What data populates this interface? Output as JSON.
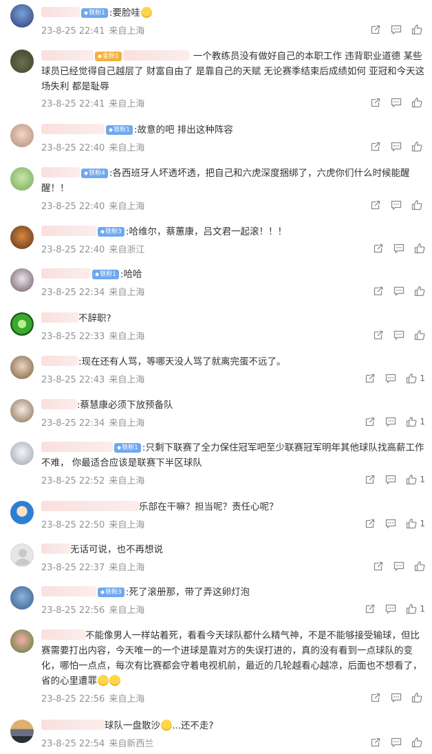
{
  "comments": [
    {
      "text": ":要脸哇",
      "emoji": "blush",
      "badge": "铁粉1",
      "badge_color": "#6fa8f0",
      "time": "23-8-25 22:41",
      "location": "来自上海",
      "likes": ""
    },
    {
      "text": "一个教练员没有做好自己的本职工作 违背职业道德 某些球员已经觉得自己越层了 财富自由了 是靠自己的天赋 无论赛季结束后成绩如何 亚冠和今天这场失利 都是耻辱",
      "badge": "金粉1",
      "badge_color": "#f3b23b",
      "time": "23-8-25 22:41",
      "location": "来自上海",
      "likes": ""
    },
    {
      "text": ":故意的吧 排出这种阵容",
      "badge": "铁粉1",
      "time": "23-8-25 22:40",
      "location": "来自上海",
      "likes": ""
    },
    {
      "text": ":各西班牙人坏透坏透，把自己和六虎深度捆绑了，六虎你们什么时候能醒醒！！",
      "badge": "铁粉4",
      "time": "23-8-25 22:40",
      "location": "来自上海",
      "likes": ""
    },
    {
      "text": ":哈维尔，蔡蕙康，吕文君一起滚！！！",
      "badge": "铁粉3",
      "time": "23-8-25 22:40",
      "location": "来自浙江",
      "likes": ""
    },
    {
      "text": ":哈哈",
      "badge": "铁粉1",
      "time": "23-8-25 22:34",
      "location": "来自上海",
      "likes": ""
    },
    {
      "text": "不辞职?",
      "badge": "",
      "time": "23-8-25 22:33",
      "location": "来自上海",
      "likes": ""
    },
    {
      "text": ":现在还有人骂，等哪天没人骂了就离完蛋不远了。",
      "badge": "",
      "time": "23-8-25 22:43",
      "location": "来自上海",
      "likes": "1"
    },
    {
      "text": ":蔡慧康必须下放预备队",
      "badge": "",
      "time": "23-8-25 22:34",
      "location": "来自上海",
      "likes": "1"
    },
    {
      "text": ":只剩下联赛了全力保住冠军吧至少联赛冠军明年其他球队找高薪工作不难， 你最适合应该是联赛下半区球队",
      "badge": "铁粉1",
      "time": "23-8-25 22:52",
      "location": "来自上海",
      "likes": "1"
    },
    {
      "text": "乐部在干嘛？担当呢？责任心呢？",
      "badge": "",
      "time": "23-8-25 22:50",
      "location": "来自上海",
      "likes": "1"
    },
    {
      "text": "无话可说，也不再想说",
      "badge": "",
      "time": "23-8-25 22:37",
      "location": "来自上海",
      "likes": ""
    },
    {
      "text": ":死了滚册那，带了弄这卵灯泡",
      "badge": "铁粉3",
      "time": "23-8-25 22:56",
      "location": "来自上海",
      "likes": "1"
    },
    {
      "text": "不能像男人一样站着死，看看今天球队都什么精气神，不是不能够接受输球，但比赛需要打出内容，今天唯一的一个进球是靠对方的失误打进的，真的没有看到一点球队的变化，哪怕一点点，每次有比赛都会守着电视机前，最近的几轮越看心越凉，后面也不想看了，省的心里遭罪",
      "emoji": "cry2",
      "badge": "",
      "time": "23-8-25 22:56",
      "location": "来自上海",
      "likes": ""
    },
    {
      "text": "球队一盘散沙",
      "emoji_mid": "sweat",
      "text2": "...还不走?",
      "badge": "",
      "time": "23-8-25 22:54",
      "location": "来自新西兰",
      "likes": ""
    }
  ],
  "icons": {
    "share": "share-icon",
    "comment": "comment-icon",
    "like": "like-icon"
  }
}
